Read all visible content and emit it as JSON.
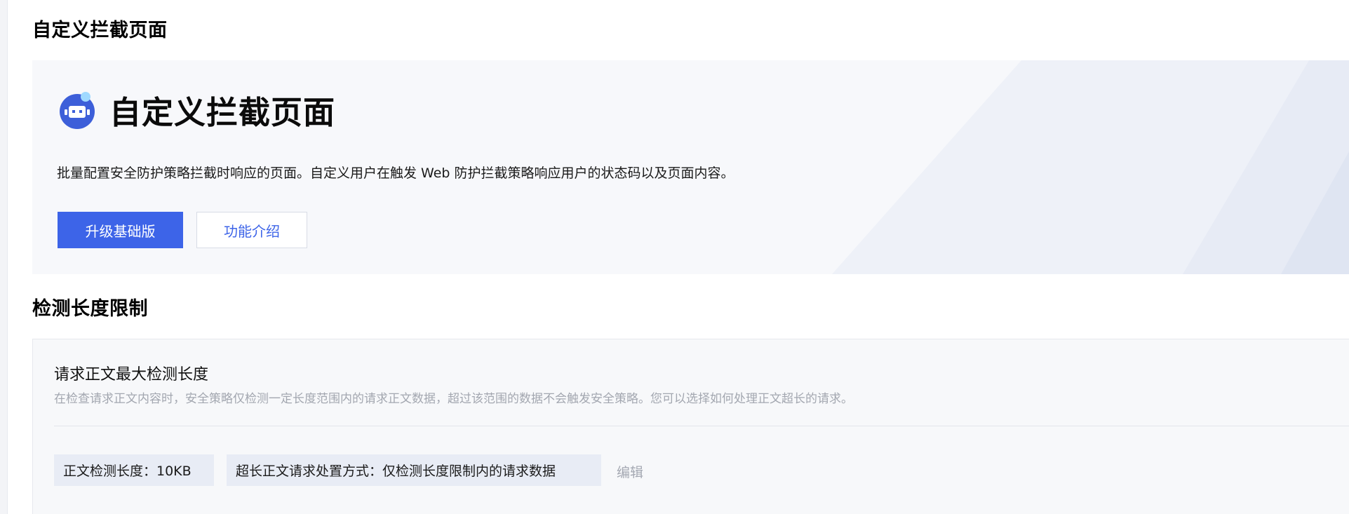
{
  "custom_block_section": {
    "title": "自定义拦截页面",
    "banner": {
      "icon": "robot-icon",
      "title": "自定义拦截页面",
      "description": "批量配置安全防护策略拦截时响应的页面。自定义用户在触发 Web 防护拦截策略响应用户的状态码以及页面内容。",
      "primary_button": "升级基础版",
      "secondary_button": "功能介绍"
    }
  },
  "detection_length_section": {
    "title": "检测长度限制",
    "card": {
      "title": "请求正文最大检测长度",
      "description": "在检查请求正文内容时，安全策略仅检测一定长度范围内的请求正文数据，超过该范围的数据不会触发安全策略。您可以选择如何处理正文超长的请求。",
      "length_tag": "正文检测长度：10KB",
      "mode_tag": "超长正文请求处置方式：仅检测长度限制内的请求数据",
      "edit_label": "编辑"
    }
  },
  "colors": {
    "accent": "#3d64e8",
    "banner_bg": "#f7f8fb",
    "card_bg": "#f7f8fa",
    "tag_bg": "#e8ecf5",
    "muted_text": "#a3a7b0"
  }
}
